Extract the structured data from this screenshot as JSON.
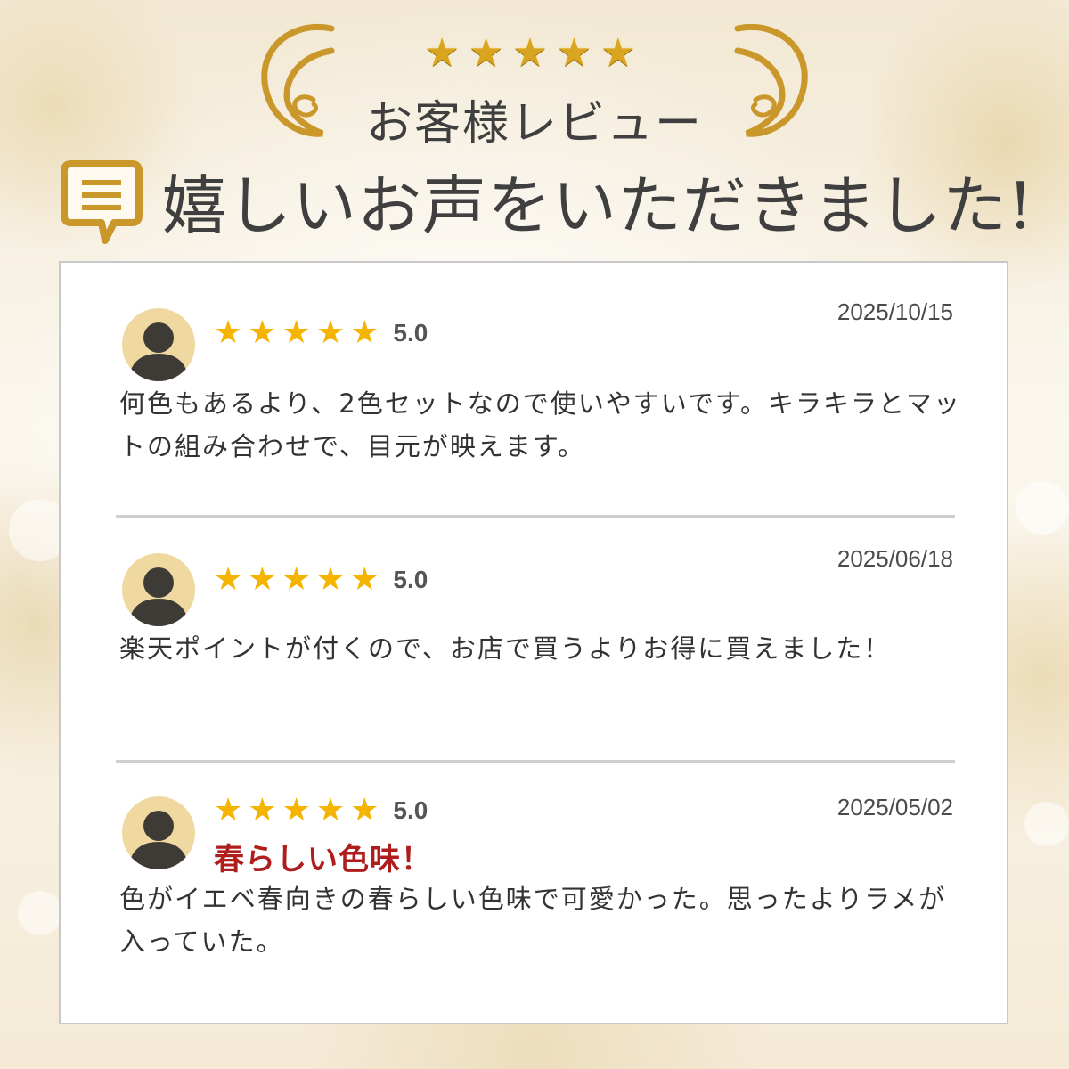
{
  "header": {
    "stars": "★★★★★",
    "subtitle": "お客様レビュー",
    "title": "嬉しいお声をいただきました!"
  },
  "colors": {
    "gold": "#d9a520",
    "star": "#f5b400",
    "accent_red": "#b01d1d",
    "text": "#333333"
  },
  "reviews": [
    {
      "stars": "★★★★★",
      "score": "5.0",
      "date": "2025/10/15",
      "title": "",
      "text": "何色もあるより、2色セットなので使いやすいです。キラキラとマットの組み合わせで、目元が映えます。"
    },
    {
      "stars": "★★★★★",
      "score": "5.0",
      "date": "2025/06/18",
      "title": "",
      "text": "楽天ポイントが付くので、お店で買うよりお得に買えました！"
    },
    {
      "stars": "★★★★★",
      "score": "5.0",
      "date": "2025/05/02",
      "title": "春らしい色味！",
      "text": "色がイエベ春向きの春らしい色味で可愛かった。思ったよりラメが入っていた。"
    }
  ]
}
